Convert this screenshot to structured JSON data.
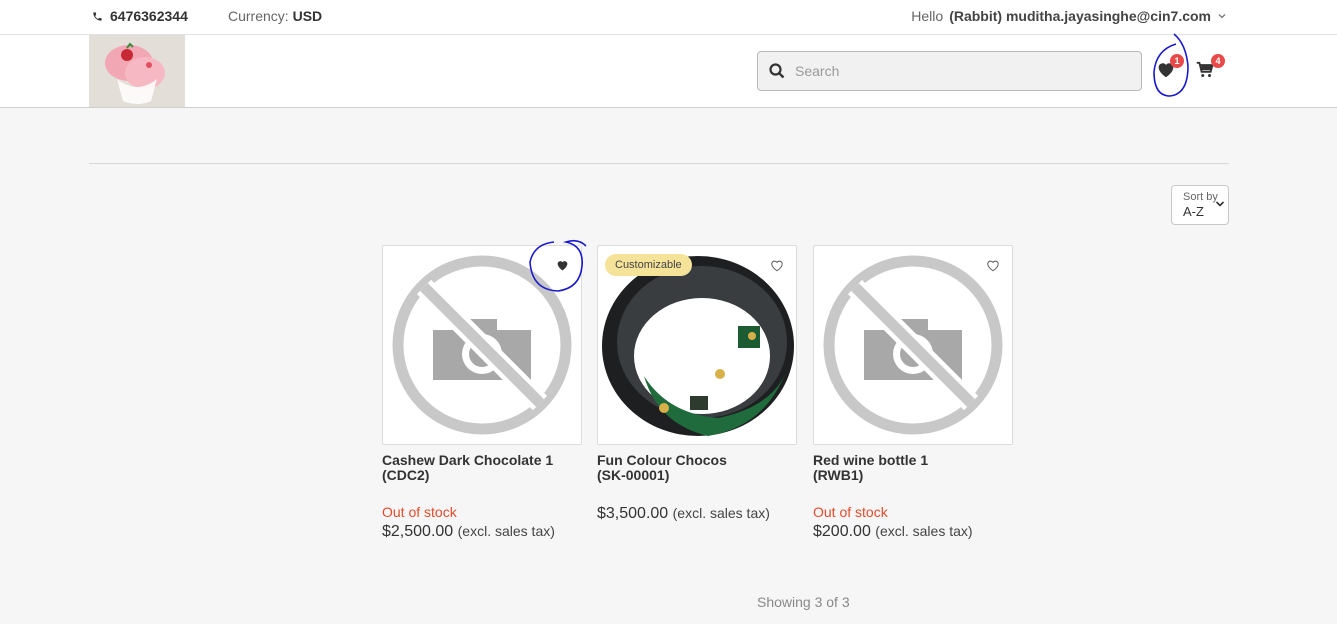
{
  "topbar": {
    "phone": "6476362344",
    "currency_label": "Currency:",
    "currency_value": "USD",
    "hello_prefix": "Hello",
    "user": "(Rabbit) muditha.jayasinghe@cin7.com"
  },
  "header": {
    "search_placeholder": "Search",
    "wishlist_count": "1",
    "cart_count": "4"
  },
  "sort": {
    "label": "Sort by",
    "value": "A-Z"
  },
  "products": [
    {
      "name": "Cashew Dark Chocolate 1",
      "sku": "(CDC2)",
      "stock": "Out of stock",
      "price": "$2,500.00",
      "tax": "(excl. sales tax)"
    },
    {
      "tag": "Customizable",
      "name": "Fun Colour Chocos",
      "sku": "(SK-00001)",
      "price": "$3,500.00",
      "tax": "(excl. sales tax)"
    },
    {
      "name": "Red wine bottle 1",
      "sku": "(RWB1)",
      "stock": "Out of stock",
      "price": "$200.00",
      "tax": "(excl. sales tax)"
    }
  ],
  "pagination": {
    "showing": "Showing 3 of 3"
  },
  "colors": {
    "badge": "#e84a4a",
    "out_of_stock": "#e14b2b",
    "tag_bg": "#f5e39a",
    "annotation": "#1a1acc"
  }
}
